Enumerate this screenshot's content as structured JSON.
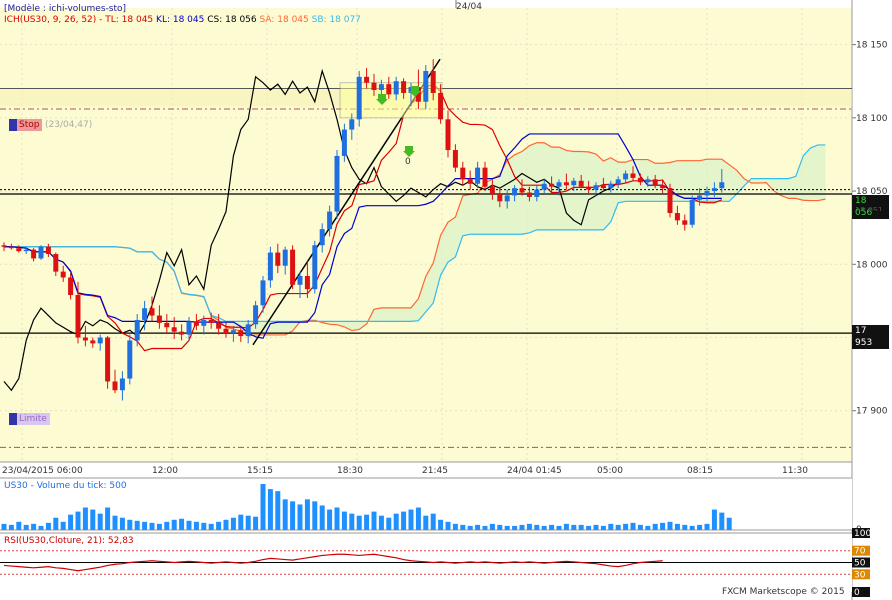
{
  "header": {
    "model": "[Modèle : ichi-volumes-sto]",
    "ich_prefix": "ICH(US30, 9, 26, 52) -",
    "tl": "TL: 18 045",
    "kl": "KL: 18 045",
    "cs": "CS: 18 056",
    "sa": "SA: 18 045",
    "sb": "SB: 18 077",
    "top_date": "24/04"
  },
  "colors": {
    "panel_bg": "#fdfbd2",
    "tenkan": "#dd0000",
    "kijun": "#0000cc",
    "chikou": "#000000",
    "senkou_a": "#ff6633",
    "senkou_b": "#33bbee",
    "cloud": "#d9f2c8",
    "bull": "#1f6fe0",
    "bear": "#dd1111",
    "volume": "#1e90ff",
    "rsi": "#cc0000"
  },
  "labels": {
    "stop": "Stop",
    "stop_date": "(23/04,47)",
    "limit": "Limite",
    "arrow_zero": "0",
    "price_now": "18 056",
    "price_now_under": "18 051",
    "price_level": "17 953",
    "volume_title": "US30 - Volume du tick: 500",
    "rsi_title": "RSI(US30,Cloture, 21): 52,83",
    "copyright": "FXCM Marketscope © 2015"
  },
  "chart_data": {
    "type": "candlestick",
    "symbol": "US30",
    "y_ticks": [
      "18 150",
      "18 100",
      "18 050",
      "18 000",
      "17 950",
      "17 900"
    ],
    "x_ticks": [
      "23/04/2015 06:00",
      "12:00",
      "15:15",
      "18:30",
      "21:45",
      "24/04 01:45",
      "05:00",
      "08:15",
      "11:30"
    ],
    "ylim": [
      17865,
      18175
    ],
    "ohlc": [
      [
        18013,
        18015,
        18009,
        18012
      ],
      [
        18012,
        18014,
        18010,
        18011
      ],
      [
        18011,
        18013,
        18008,
        18009
      ],
      [
        18009,
        18012,
        18007,
        18010
      ],
      [
        18010,
        18011,
        18002,
        18004
      ],
      [
        18004,
        18013,
        18003,
        18012
      ],
      [
        18012,
        18014,
        18005,
        18007
      ],
      [
        18007,
        18008,
        17992,
        17995
      ],
      [
        17995,
        17999,
        17988,
        17991
      ],
      [
        17991,
        17994,
        17976,
        17979
      ],
      [
        17979,
        17988,
        17946,
        17950
      ],
      [
        17950,
        17958,
        17944,
        17948
      ],
      [
        17948,
        17950,
        17943,
        17946
      ],
      [
        17946,
        17952,
        17941,
        17950
      ],
      [
        17950,
        17951,
        17915,
        17920
      ],
      [
        17920,
        17928,
        17912,
        17914
      ],
      [
        17914,
        17927,
        17907,
        17922
      ],
      [
        17922,
        17952,
        17918,
        17948
      ],
      [
        17948,
        17966,
        17944,
        17962
      ],
      [
        17962,
        17975,
        17955,
        17970
      ],
      [
        17970,
        17978,
        17961,
        17965
      ],
      [
        17965,
        17972,
        17956,
        17960
      ],
      [
        17960,
        17966,
        17953,
        17957
      ],
      [
        17957,
        17964,
        17949,
        17954
      ],
      [
        17954,
        17959,
        17948,
        17952
      ],
      [
        17952,
        17964,
        17948,
        17961
      ],
      [
        17961,
        17966,
        17955,
        17958
      ],
      [
        17958,
        17965,
        17952,
        17962
      ],
      [
        17962,
        17967,
        17956,
        17960
      ],
      [
        17960,
        17966,
        17952,
        17956
      ],
      [
        17956,
        17960,
        17950,
        17953
      ],
      [
        17953,
        17958,
        17947,
        17955
      ],
      [
        17955,
        17957,
        17947,
        17951
      ],
      [
        17951,
        17962,
        17946,
        17959
      ],
      [
        17959,
        17975,
        17956,
        17972
      ],
      [
        17972,
        17992,
        17967,
        17989
      ],
      [
        17989,
        18012,
        17984,
        18008
      ],
      [
        18008,
        18014,
        17994,
        17999
      ],
      [
        17999,
        18012,
        17993,
        18010
      ],
      [
        18010,
        18013,
        17983,
        17986
      ],
      [
        17986,
        17995,
        17977,
        17992
      ],
      [
        17992,
        18002,
        17977,
        17983
      ],
      [
        17983,
        18016,
        17980,
        18013
      ],
      [
        18013,
        18028,
        18008,
        18024
      ],
      [
        18024,
        18040,
        18019,
        18036
      ],
      [
        18036,
        18078,
        18031,
        18074
      ],
      [
        18074,
        18096,
        18070,
        18092
      ],
      [
        18092,
        18103,
        18085,
        18099
      ],
      [
        18099,
        18132,
        18094,
        18128
      ],
      [
        18128,
        18134,
        18120,
        18124
      ],
      [
        18124,
        18130,
        18115,
        18119
      ],
      [
        18119,
        18126,
        18110,
        18123
      ],
      [
        18123,
        18128,
        18113,
        18116
      ],
      [
        18116,
        18128,
        18112,
        18125
      ],
      [
        18125,
        18127,
        18113,
        18117
      ],
      [
        18117,
        18124,
        18108,
        18121
      ],
      [
        18121,
        18133,
        18106,
        18111
      ],
      [
        18111,
        18136,
        18106,
        18132
      ],
      [
        18132,
        18140,
        18112,
        18117
      ],
      [
        18117,
        18123,
        18096,
        18099
      ],
      [
        18099,
        18105,
        18073,
        18078
      ],
      [
        18078,
        18082,
        18063,
        18066
      ],
      [
        18066,
        18070,
        18054,
        18058
      ],
      [
        18058,
        18064,
        18051,
        18055
      ],
      [
        18055,
        18070,
        18052,
        18066
      ],
      [
        18066,
        18070,
        18050,
        18053
      ],
      [
        18053,
        18058,
        18044,
        18048
      ],
      [
        18048,
        18052,
        18039,
        18043
      ],
      [
        18043,
        18051,
        18038,
        18047
      ],
      [
        18047,
        18054,
        18043,
        18052
      ],
      [
        18052,
        18058,
        18047,
        18049
      ],
      [
        18049,
        18053,
        18043,
        18046
      ],
      [
        18046,
        18054,
        18043,
        18051
      ],
      [
        18051,
        18058,
        18048,
        18055
      ],
      [
        18055,
        18060,
        18049,
        18053
      ],
      [
        18053,
        18058,
        18047,
        18056
      ],
      [
        18056,
        18062,
        18051,
        18054
      ],
      [
        18054,
        18059,
        18050,
        18057
      ],
      [
        18057,
        18061,
        18052,
        18053
      ],
      [
        18053,
        18057,
        18048,
        18051
      ],
      [
        18051,
        18056,
        18047,
        18054
      ],
      [
        18054,
        18059,
        18050,
        18052
      ],
      [
        18052,
        18057,
        18049,
        18055
      ],
      [
        18055,
        18060,
        18052,
        18058
      ],
      [
        18058,
        18064,
        18055,
        18062
      ],
      [
        18062,
        18067,
        18057,
        18059
      ],
      [
        18059,
        18062,
        18054,
        18056
      ],
      [
        18056,
        18060,
        18053,
        18058
      ],
      [
        18058,
        18061,
        18052,
        18054
      ],
      [
        18054,
        18058,
        18048,
        18052
      ],
      [
        18052,
        18055,
        18032,
        18035
      ],
      [
        18035,
        18040,
        18027,
        18030
      ],
      [
        18030,
        18034,
        18023,
        18027
      ],
      [
        18027,
        18047,
        18025,
        18044
      ],
      [
        18044,
        18052,
        18040,
        18047
      ],
      [
        18047,
        18053,
        18043,
        18050
      ],
      [
        18050,
        18056,
        18046,
        18052
      ],
      [
        18052,
        18065,
        18049,
        18056
      ]
    ],
    "volume": [
      6,
      5,
      8,
      5,
      6,
      4,
      7,
      12,
      8,
      15,
      18,
      22,
      20,
      16,
      22,
      14,
      12,
      10,
      9,
      8,
      7,
      6,
      8,
      10,
      11,
      9,
      8,
      7,
      6,
      8,
      10,
      12,
      15,
      14,
      13,
      45,
      40,
      38,
      30,
      28,
      25,
      30,
      28,
      24,
      20,
      22,
      18,
      16,
      14,
      15,
      18,
      14,
      12,
      16,
      18,
      20,
      22,
      14,
      16,
      10,
      8,
      6,
      5,
      4,
      5,
      4,
      6,
      5,
      4,
      4,
      5,
      6,
      5,
      4,
      5,
      4,
      6,
      5,
      5,
      4,
      5,
      4,
      6,
      5,
      6,
      7,
      5,
      4,
      6,
      7,
      8,
      6,
      5,
      4,
      5,
      6,
      20,
      17,
      12
    ],
    "rsi": [
      45,
      44,
      43,
      42,
      41,
      42,
      43,
      41,
      40,
      38,
      36,
      38,
      40,
      42,
      45,
      47,
      48,
      50,
      51,
      52,
      53,
      52,
      51,
      50,
      51,
      52,
      51,
      50,
      49,
      50,
      51,
      50,
      49,
      50,
      52,
      55,
      57,
      56,
      55,
      54,
      56,
      58,
      60,
      62,
      63,
      64,
      64,
      63,
      62,
      63,
      64,
      62,
      60,
      58,
      55,
      53,
      52,
      51,
      50,
      51,
      50,
      49,
      50,
      51,
      50,
      51,
      50,
      49,
      50,
      51,
      50,
      51,
      50,
      49,
      50,
      51,
      52,
      51,
      50,
      49,
      48,
      46,
      44,
      43,
      45,
      48,
      50,
      51,
      52,
      53
    ]
  }
}
